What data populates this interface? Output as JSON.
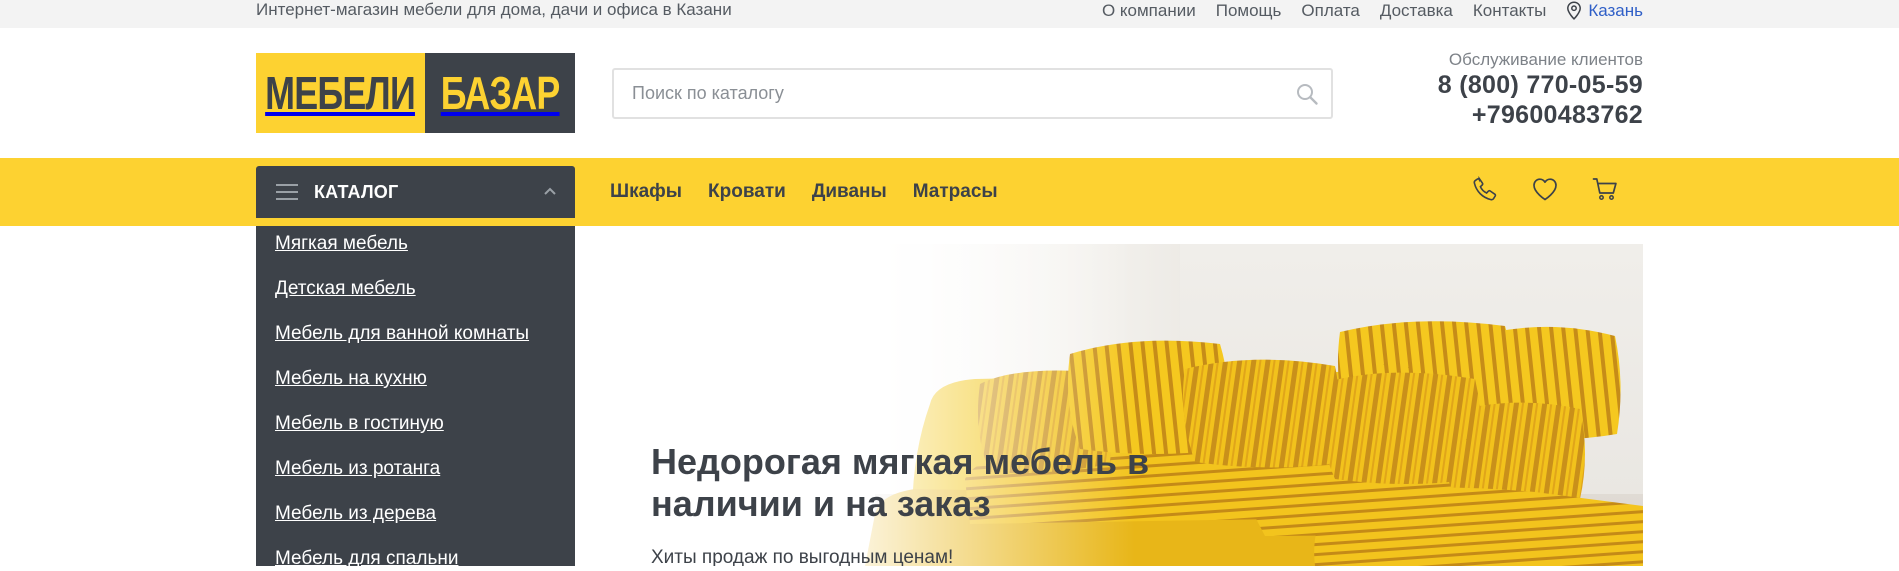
{
  "topbar": {
    "tagline": "Интернет-магазин мебели для дома, дачи и офиса в Казани",
    "links": [
      "О компании",
      "Помощь",
      "Оплата",
      "Доставка",
      "Контакты"
    ],
    "city": "Казань"
  },
  "header": {
    "logo_left": "МЕБЕЛИ",
    "logo_right": "БАЗАР",
    "search_placeholder": "Поиск по каталогу",
    "service_label": "Обслуживание клиентов",
    "phone_1": "8 (800) 770-05-59",
    "phone_2": "+79600483762"
  },
  "navbar": {
    "catalog_label": "КАТАЛОГ",
    "links": [
      "Шкафы",
      "Кровати",
      "Диваны",
      "Матрасы"
    ],
    "icons": [
      "phone-icon",
      "heart-icon",
      "cart-icon"
    ]
  },
  "catalog_menu": [
    "Мягкая мебель",
    "Детская мебель",
    "Мебель для ванной комнаты",
    "Мебель на кухню",
    "Мебель в гостиную",
    "Мебель из ротанга",
    "Мебель из дерева",
    "Мебель для спальни"
  ],
  "hero": {
    "title": "Недорогая мягкая мебель в наличии и на заказ",
    "subtitle": "Хиты продаж по выгодным ценам!"
  },
  "colors": {
    "brand_yellow": "#fdd231",
    "brand_dark": "#3d4249",
    "link_blue": "#2f5fc7"
  }
}
